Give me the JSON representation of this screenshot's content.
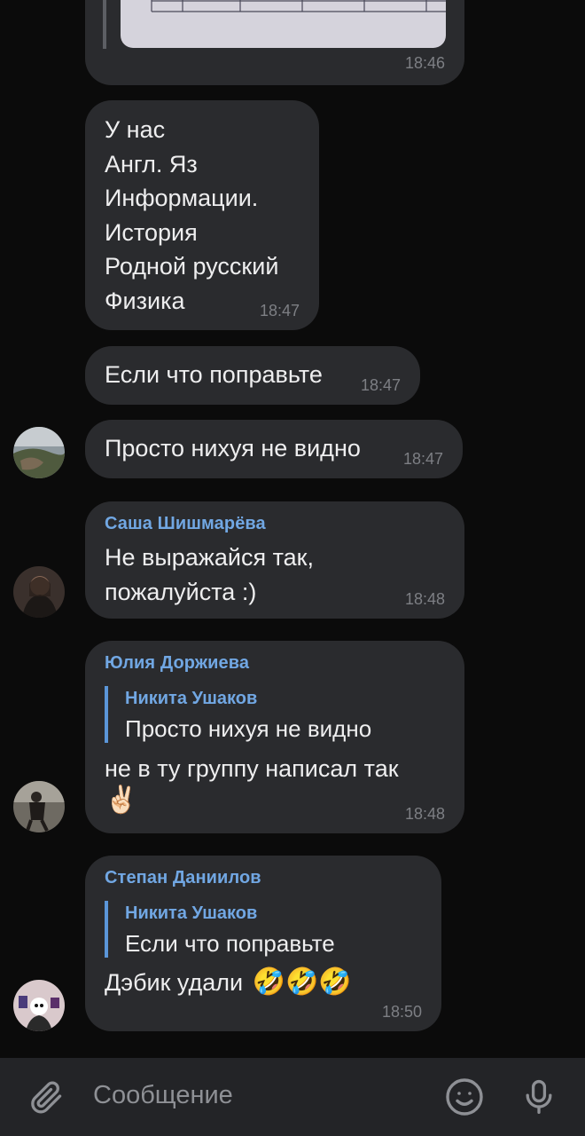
{
  "messages": [
    {
      "time": "18:46"
    },
    {
      "lines": [
        "У нас",
        "Англ. Яз",
        "Информации.",
        "История",
        "Родной русский",
        "Физика"
      ],
      "time": "18:47"
    },
    {
      "text": "Если что поправьте",
      "time": "18:47"
    },
    {
      "text": "Просто нихуя не видно",
      "time": "18:47"
    },
    {
      "sender": "Саша Шишмарёва",
      "lines": [
        "Не выражайся так,",
        "пожалуйста :)"
      ],
      "time": "18:48"
    },
    {
      "sender": "Юлия Доржиева",
      "reply_name": "Никита Ушаков",
      "reply_text": "Просто нихуя не видно",
      "text": "не в ту группу написал так",
      "emoji": "✌🏻",
      "time": "18:48"
    },
    {
      "sender": "Степан Даниилов",
      "reply_name": "Никита Ушаков",
      "reply_text": "Если что поправьте",
      "text": "Дэбик удали",
      "emoji": "🤣🤣🤣",
      "time": "18:50"
    }
  ],
  "input": {
    "placeholder": "Сообщение"
  },
  "icons": {
    "attach": "paperclip-icon",
    "emoji": "smiley-icon",
    "mic": "microphone-icon"
  },
  "colors": {
    "background": "#0b0b0b",
    "bubble": "#2a2b2e",
    "accent": "#71a7e3",
    "bottom_bar": "#232427"
  }
}
